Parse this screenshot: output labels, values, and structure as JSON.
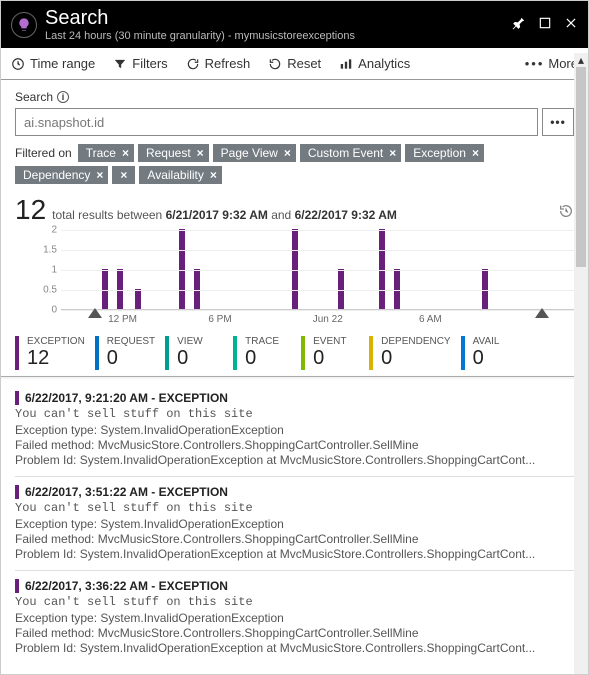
{
  "header": {
    "title": "Search",
    "subtitle": "Last 24 hours (30 minute granularity) - mymusicstoreexceptions"
  },
  "toolbar": {
    "time_range": "Time range",
    "filters": "Filters",
    "refresh": "Refresh",
    "reset": "Reset",
    "analytics": "Analytics",
    "more": "More"
  },
  "search": {
    "label": "Search",
    "value": "ai.snapshot.id",
    "more": "•••"
  },
  "filter": {
    "label": "Filtered on",
    "chips": [
      "Trace",
      "Request",
      "Page View",
      "Custom Event",
      "Exception",
      "Dependency",
      "Availability"
    ]
  },
  "results": {
    "count": "12",
    "text_a": "total results between",
    "from": "6/21/2017 9:32 AM",
    "text_b": "and",
    "to": "6/22/2017 9:32 AM"
  },
  "chart_data": {
    "type": "bar",
    "ylim": [
      0,
      2
    ],
    "yticks": [
      0,
      0.5,
      1,
      1.5,
      2
    ],
    "xticks": [
      {
        "pos": 12,
        "label": "12 PM"
      },
      {
        "pos": 31,
        "label": "6 PM"
      },
      {
        "pos": 52,
        "label": "Jun 22"
      },
      {
        "pos": 72,
        "label": "6 AM"
      }
    ],
    "bars": [
      {
        "pos": 8,
        "value": 1
      },
      {
        "pos": 11,
        "value": 1
      },
      {
        "pos": 14.5,
        "value": 0.5
      },
      {
        "pos": 23,
        "value": 2
      },
      {
        "pos": 26,
        "value": 1
      },
      {
        "pos": 45,
        "value": 2
      },
      {
        "pos": 54,
        "value": 1
      },
      {
        "pos": 62,
        "value": 2
      },
      {
        "pos": 65,
        "value": 1
      },
      {
        "pos": 82,
        "value": 1
      }
    ],
    "handles": {
      "left": 6,
      "right": 86
    }
  },
  "metrics": [
    {
      "label": "EXCEPTION",
      "value": "12",
      "color": "#68207a"
    },
    {
      "label": "REQUEST",
      "value": "0",
      "color": "#0072c6"
    },
    {
      "label": "VIEW",
      "value": "0",
      "color": "#009e8f"
    },
    {
      "label": "TRACE",
      "value": "0",
      "color": "#00b294"
    },
    {
      "label": "EVENT",
      "value": "0",
      "color": "#7fba00"
    },
    {
      "label": "DEPENDENCY",
      "value": "0",
      "color": "#d9b300"
    },
    {
      "label": "AVAIL",
      "value": "0",
      "color": "#0078d4"
    }
  ],
  "items": [
    {
      "head": "6/22/2017, 9:21:20 AM - EXCEPTION",
      "msg": "You can't sell stuff on this site",
      "l1": "Exception type: System.InvalidOperationException",
      "l2": "Failed method: MvcMusicStore.Controllers.ShoppingCartController.SellMine",
      "l3": "Problem Id: System.InvalidOperationException at MvcMusicStore.Controllers.ShoppingCartCont..."
    },
    {
      "head": "6/22/2017, 3:51:22 AM - EXCEPTION",
      "msg": "You can't sell stuff on this site",
      "l1": "Exception type: System.InvalidOperationException",
      "l2": "Failed method: MvcMusicStore.Controllers.ShoppingCartController.SellMine",
      "l3": "Problem Id: System.InvalidOperationException at MvcMusicStore.Controllers.ShoppingCartCont..."
    },
    {
      "head": "6/22/2017, 3:36:22 AM - EXCEPTION",
      "msg": "You can't sell stuff on this site",
      "l1": "Exception type: System.InvalidOperationException",
      "l2": "Failed method: MvcMusicStore.Controllers.ShoppingCartController.SellMine",
      "l3": "Problem Id: System.InvalidOperationException at MvcMusicStore.Controllers.ShoppingCartCont..."
    }
  ]
}
